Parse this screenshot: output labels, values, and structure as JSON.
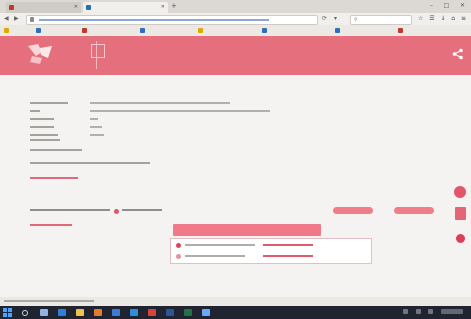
{
  "browser": {
    "tabs": [
      {
        "label": ""
      },
      {
        "label": ""
      }
    ],
    "new_tab_glyph": "+",
    "window_controls": [
      "–",
      "□",
      "✕"
    ],
    "url": "",
    "search_placeholder": "",
    "toolbar_icons": [
      "star-icon",
      "reading-list-icon",
      "download-icon",
      "home-icon",
      "menu-icon"
    ]
  },
  "site": {
    "header_title": "",
    "header_subtitle": "",
    "brand_color": "#e66f7e"
  },
  "details": {
    "rows": [
      {
        "label": ""
      },
      {
        "label": ""
      },
      {
        "label": ""
      },
      {
        "label": ""
      },
      {
        "label": ""
      }
    ]
  },
  "results": {
    "summary": "",
    "button_1": "",
    "button_2": ""
  },
  "actions": {
    "big_button": "",
    "popup_items": [
      {
        "text": "",
        "link": ""
      },
      {
        "text": "",
        "link": ""
      }
    ]
  },
  "statusbar": {
    "text": ""
  },
  "taskbar": {
    "clock": ""
  }
}
